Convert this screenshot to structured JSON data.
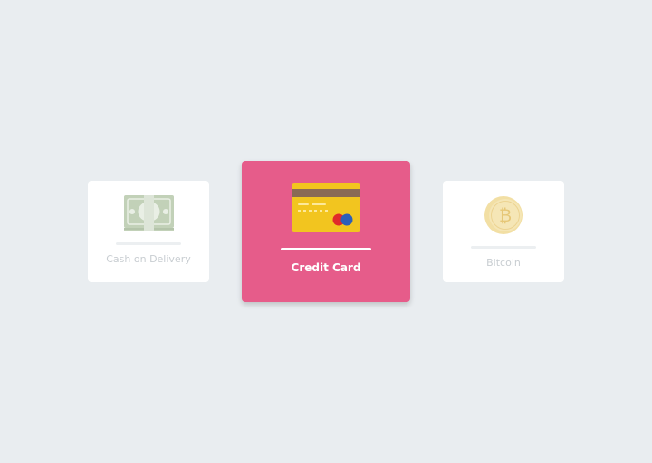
{
  "payment_options": {
    "cash": {
      "label": "Cash on Delivery",
      "icon": "cash-icon",
      "selected": false
    },
    "credit_card": {
      "label": "Credit Card",
      "icon": "credit-card-icon",
      "selected": true
    },
    "bitcoin": {
      "label": "Bitcoin",
      "icon": "bitcoin-icon",
      "selected": false
    }
  },
  "colors": {
    "background": "#e9edf0",
    "selected_card": "#e65c8a",
    "card": "#ffffff",
    "muted_text": "#c8cdd1"
  }
}
